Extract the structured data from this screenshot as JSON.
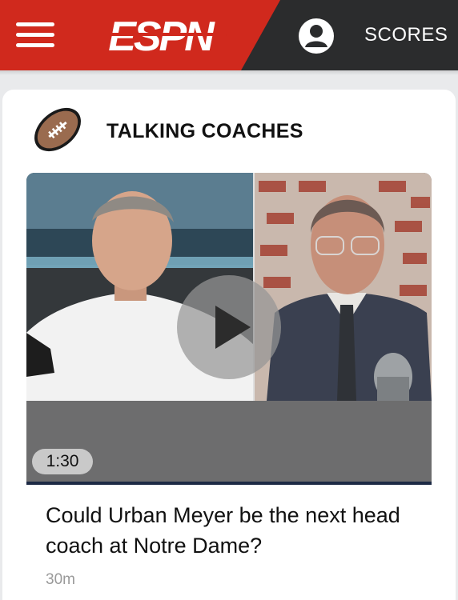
{
  "header": {
    "menu_icon": "hamburger-menu-icon",
    "logo_text": "ESPN",
    "profile_icon": "user-profile-icon",
    "scores_label": "SCORES",
    "colors": {
      "brand_red": "#d0291d",
      "dark": "#2b2c2d"
    }
  },
  "section": {
    "icon": "football-icon",
    "title": "TALKING COACHES"
  },
  "video": {
    "play_icon": "play-icon",
    "duration": "1:30"
  },
  "story": {
    "headline": "Could Urban Meyer be the next head coach at Notre Dame?",
    "timestamp": "30m"
  }
}
